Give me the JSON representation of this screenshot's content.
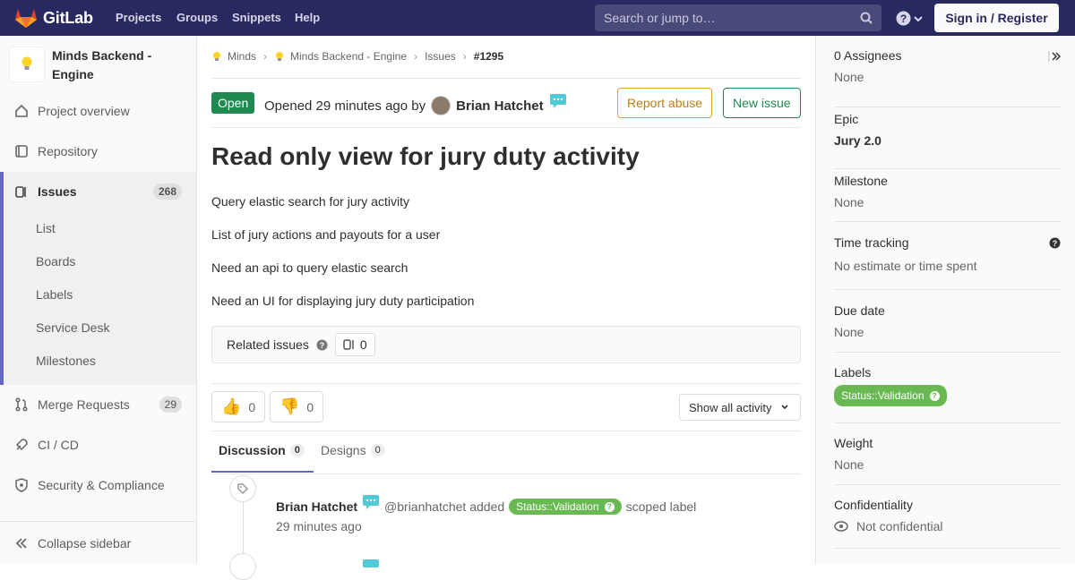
{
  "topbar": {
    "brand": "GitLab",
    "nav": [
      "Projects",
      "Groups",
      "Snippets",
      "Help"
    ],
    "search_placeholder": "Search or jump to…",
    "signin": "Sign in / Register"
  },
  "sidebar": {
    "project_name": "Minds Backend - Engine",
    "items": {
      "overview": "Project overview",
      "repository": "Repository",
      "issues": "Issues",
      "issues_count": "268",
      "list": "List",
      "boards": "Boards",
      "labels": "Labels",
      "service_desk": "Service Desk",
      "milestones": "Milestones",
      "merge_requests": "Merge Requests",
      "mr_count": "29",
      "cicd": "CI / CD",
      "security": "Security & Compliance",
      "collapse": "Collapse sidebar"
    }
  },
  "breadcrumb": [
    "Minds",
    "Minds Backend - Engine",
    "Issues",
    "#1295"
  ],
  "issue": {
    "status": "Open",
    "opened_text": "Opened 29 minutes ago by",
    "author": "Brian Hatchet",
    "report_abuse": "Report abuse",
    "new_issue": "New issue",
    "title": "Read only view for jury duty activity",
    "description": [
      "Query elastic search for jury activity",
      "List of jury actions and payouts for a user",
      "Need an api to query elastic search",
      "Need an UI for displaying jury duty participation"
    ],
    "related_label": "Related issues",
    "related_count": "0",
    "thumbs_up": "0",
    "thumbs_down": "0",
    "show_all": "Show all activity"
  },
  "tabs": {
    "discussion": "Discussion",
    "discussion_count": "0",
    "designs": "Designs",
    "designs_count": "0"
  },
  "note": {
    "author": "Brian Hatchet",
    "username": "@brianhatchet added",
    "label": "Status::Validation",
    "suffix": "scoped label",
    "time": "29 minutes ago"
  },
  "right": {
    "assignees_title": "0 Assignees",
    "assignees_val": "None",
    "epic_title": "Epic",
    "epic_val": "Jury 2.0",
    "milestone_title": "Milestone",
    "milestone_val": "None",
    "time_title": "Time tracking",
    "time_val": "No estimate or time spent",
    "due_title": "Due date",
    "due_val": "None",
    "labels_title": "Labels",
    "label": "Status::Validation",
    "weight_title": "Weight",
    "weight_val": "None",
    "conf_title": "Confidentiality",
    "conf_val": "Not confidential"
  },
  "colors": {
    "topbar": "#292961",
    "open": "#1f8a4f",
    "label": "#69b953",
    "accent": "#6666c4"
  }
}
